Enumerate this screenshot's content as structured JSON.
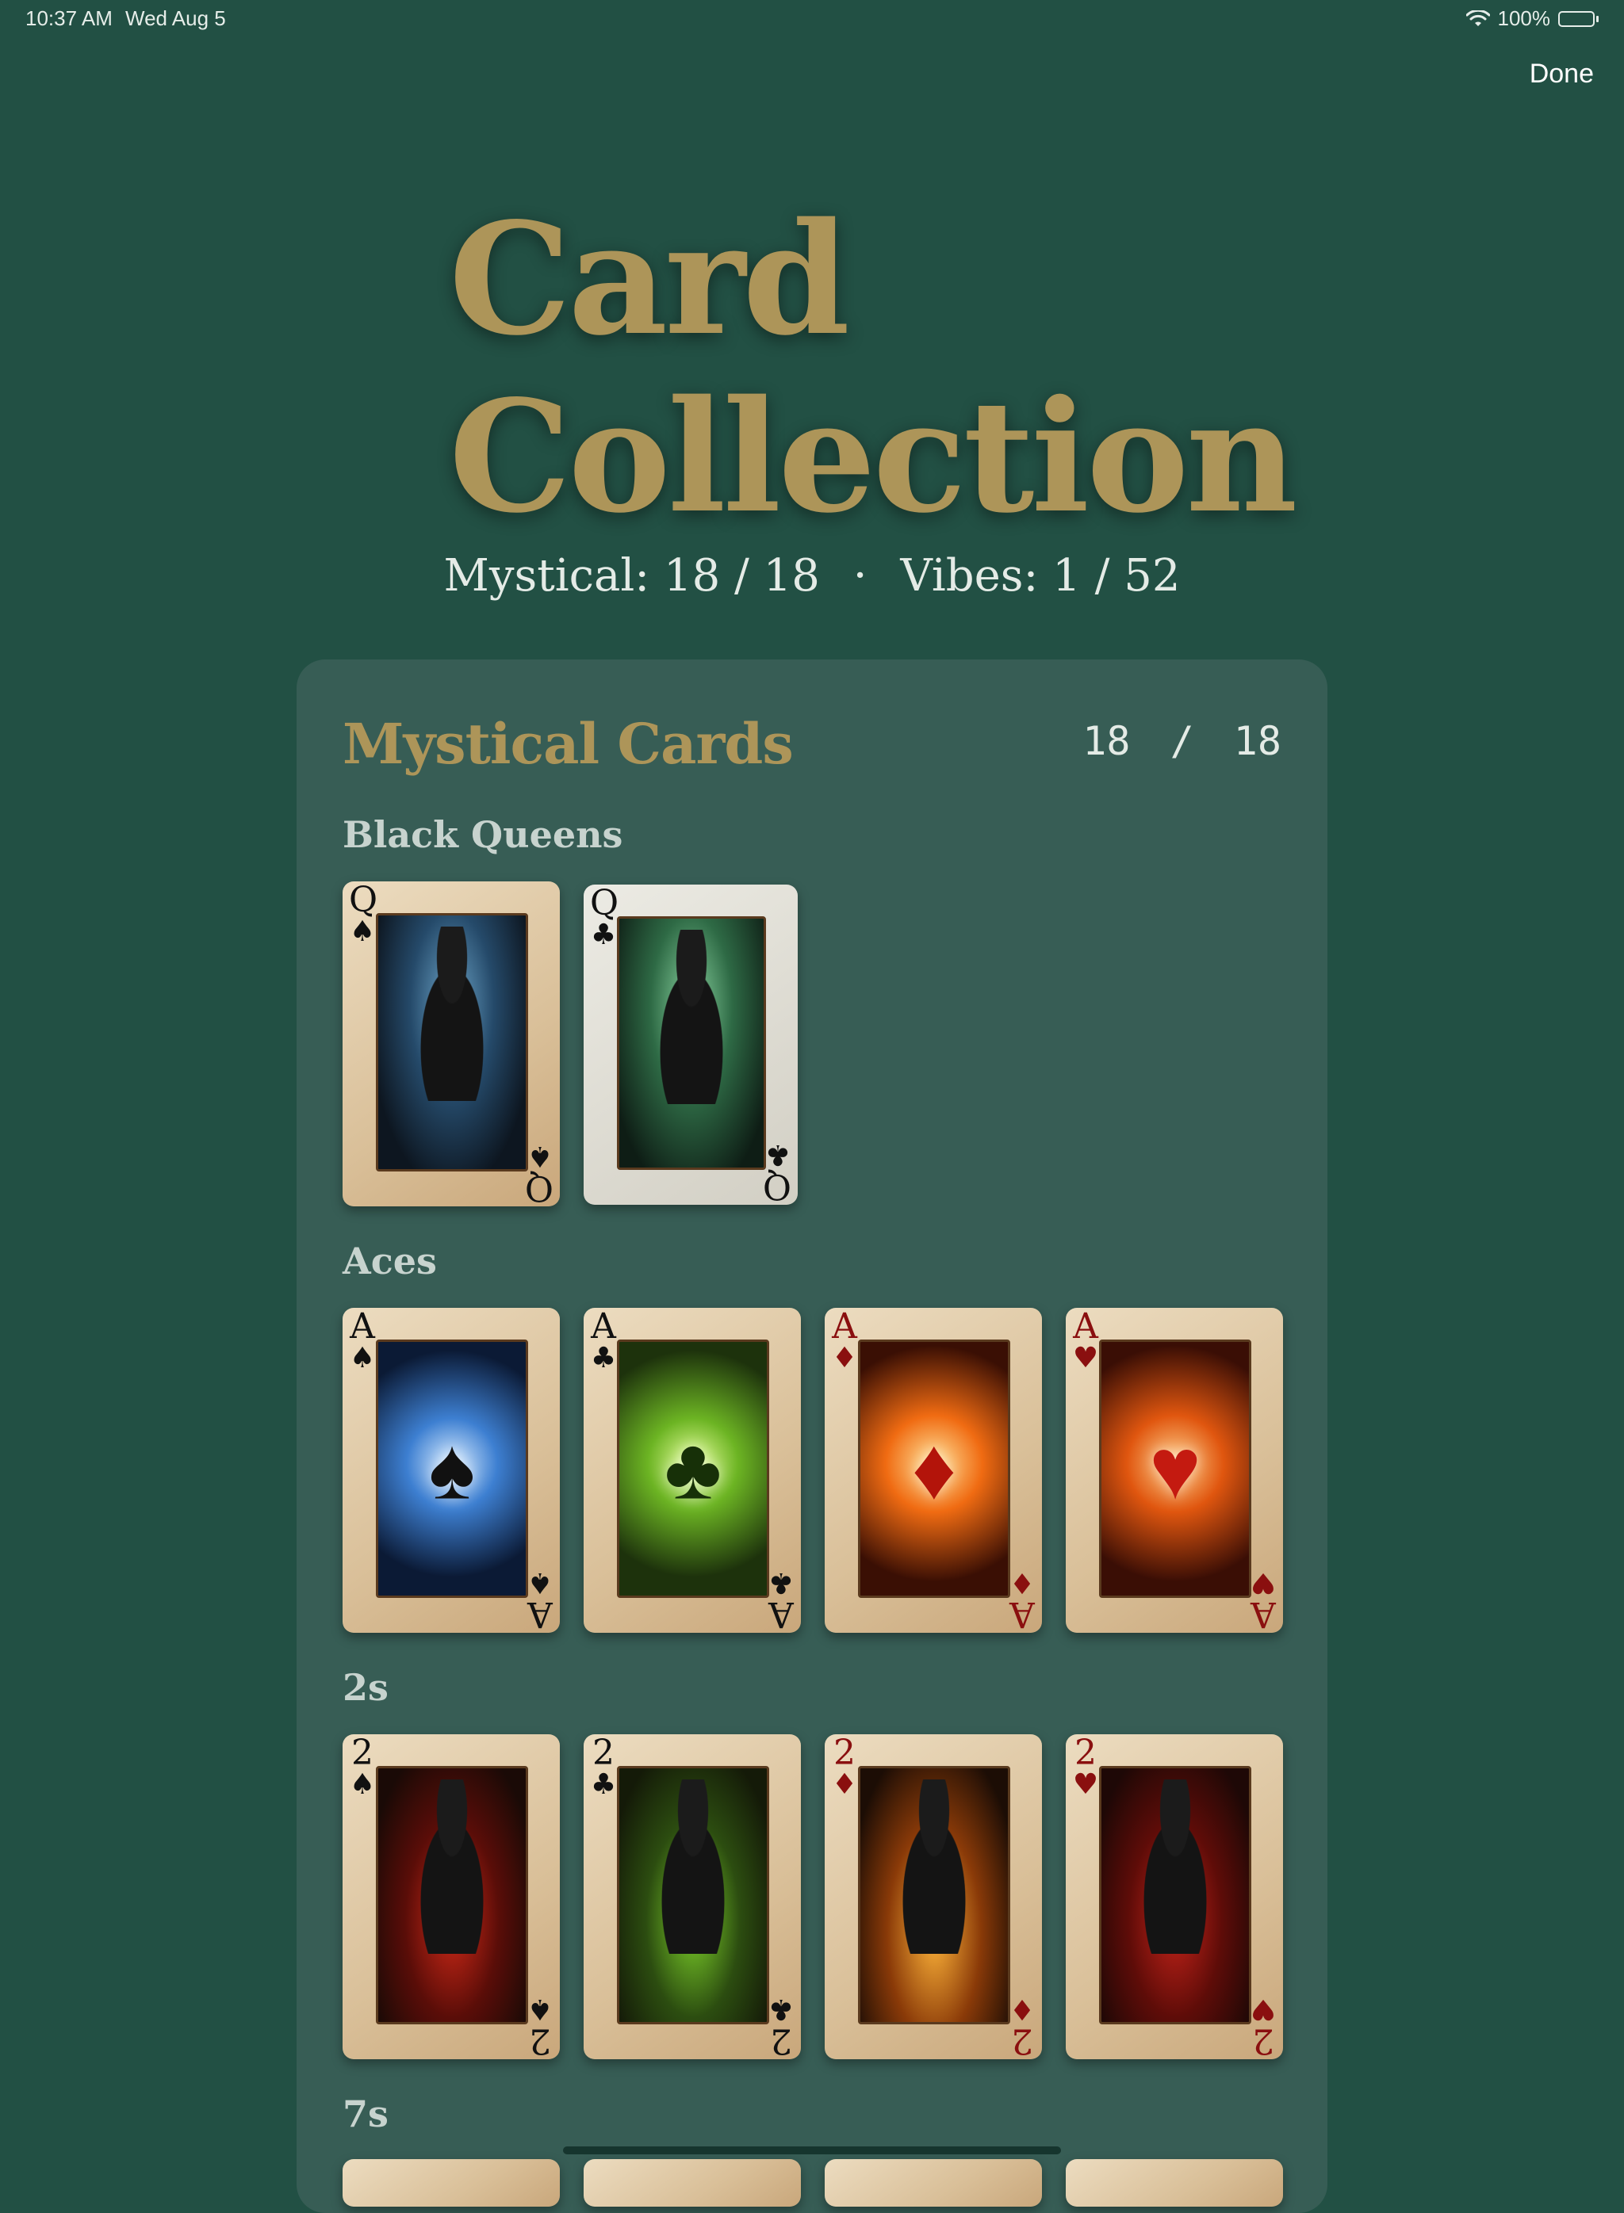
{
  "status_bar": {
    "time": "10:37 AM",
    "date": "Wed Aug 5",
    "battery": "100%"
  },
  "nav": {
    "done_label": "Done"
  },
  "header": {
    "title_line1": "Card",
    "title_line2": "Collection",
    "mystical_stat": "Mystical: 18 / 18",
    "separator": "·",
    "vibes_stat": "Vibes: 1 / 52"
  },
  "panel": {
    "title": "Mystical Cards",
    "count_collected": "18",
    "count_sep": "/",
    "count_total": "18",
    "sections": [
      {
        "title": "Black Queens",
        "cards": [
          {
            "rank": "Q",
            "suit": "♠"
          },
          {
            "rank": "Q",
            "suit": "♣"
          }
        ]
      },
      {
        "title": "Aces",
        "cards": [
          {
            "rank": "A",
            "suit": "♠"
          },
          {
            "rank": "A",
            "suit": "♣"
          },
          {
            "rank": "A",
            "suit": "♦"
          },
          {
            "rank": "A",
            "suit": "♥"
          }
        ]
      },
      {
        "title": "2s",
        "cards": [
          {
            "rank": "2",
            "suit": "♠"
          },
          {
            "rank": "2",
            "suit": "♣"
          },
          {
            "rank": "2",
            "suit": "♦"
          },
          {
            "rank": "2",
            "suit": "♥"
          }
        ]
      },
      {
        "title": "7s",
        "cards": []
      }
    ]
  },
  "colors": {
    "background": "#225044",
    "panel": "#375d55",
    "title_gold": "#ad9559",
    "suit_red": "#8a0f0f",
    "suit_black": "#111111"
  },
  "battery_level": 1.0
}
